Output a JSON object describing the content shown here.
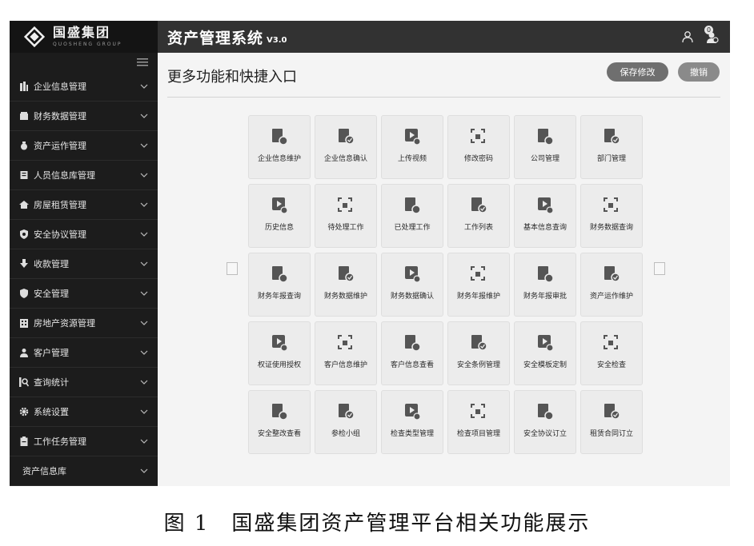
{
  "brand": {
    "name": "国盛集团",
    "sub": "QUOSHENG GROUP"
  },
  "system": {
    "title": "资产管理系统",
    "version": "V3.0"
  },
  "header": {
    "notification_count": "0"
  },
  "sidebar": {
    "items": [
      {
        "label": "企业信息管理",
        "icon": "building-icon"
      },
      {
        "label": "财务数据管理",
        "icon": "wallet-icon"
      },
      {
        "label": "资产运作管理",
        "icon": "money-bag-icon"
      },
      {
        "label": "人员信息库管理",
        "icon": "id-card-icon"
      },
      {
        "label": "房屋租赁管理",
        "icon": "house-icon"
      },
      {
        "label": "安全协议管理",
        "icon": "shield-gear-icon"
      },
      {
        "label": "收款管理",
        "icon": "download-icon"
      },
      {
        "label": "安全管理",
        "icon": "shield-icon"
      },
      {
        "label": "房地产资源管理",
        "icon": "office-building-icon"
      },
      {
        "label": "客户管理",
        "icon": "person-icon"
      },
      {
        "label": "查询统计",
        "icon": "search-doc-icon"
      },
      {
        "label": "系统设置",
        "icon": "gear-icon"
      },
      {
        "label": "工作任务管理",
        "icon": "clipboard-icon"
      },
      {
        "label": "资产信息库",
        "icon": ""
      }
    ]
  },
  "page": {
    "title": "更多功能和快捷入口",
    "save_label": "保存修改",
    "cancel_label": "撤销"
  },
  "tiles": [
    {
      "label": "企业信息维护",
      "icon": "doc-gear-icon"
    },
    {
      "label": "企业信息确认",
      "icon": "doc-check-icon"
    },
    {
      "label": "上传视频",
      "icon": "video-upload-icon"
    },
    {
      "label": "修改密码",
      "icon": "lock-scan-icon"
    },
    {
      "label": "公司管理",
      "icon": "doc-person-icon"
    },
    {
      "label": "部门管理",
      "icon": "shield-star-icon"
    },
    {
      "label": "历史信息",
      "icon": "barcode-icon"
    },
    {
      "label": "待处理工作",
      "icon": "doc-clock-icon"
    },
    {
      "label": "已处理工作",
      "icon": "doc-done-icon"
    },
    {
      "label": "工作列表",
      "icon": "clipboard-list-icon"
    },
    {
      "label": "基本信息查询",
      "icon": "doc-search-icon"
    },
    {
      "label": "财务数据查询",
      "icon": "magnifier-chart-icon"
    },
    {
      "label": "财务年报查询",
      "icon": "magnifier-icon"
    },
    {
      "label": "财务数据维护",
      "icon": "bars-gear-icon"
    },
    {
      "label": "财务数据确认",
      "icon": "bars-check-icon"
    },
    {
      "label": "财务年报维护",
      "icon": "trend-gear-icon"
    },
    {
      "label": "财务年报审批",
      "icon": "trend-check-icon"
    },
    {
      "label": "资产运作维护",
      "icon": "frame-gear-icon"
    },
    {
      "label": "权证使用授权",
      "icon": "certificate-icon"
    },
    {
      "label": "客户信息维护",
      "icon": "contact-card-icon"
    },
    {
      "label": "客户信息查看",
      "icon": "badge-card-icon"
    },
    {
      "label": "安全条例管理",
      "icon": "doc-shield-icon"
    },
    {
      "label": "安全模板定制",
      "icon": "blocks-icon"
    },
    {
      "label": "安全检查",
      "icon": "shield-star-icon"
    },
    {
      "label": "安全整改查看",
      "icon": "clipboard-edit-icon"
    },
    {
      "label": "参检小组",
      "icon": "group-icon"
    },
    {
      "label": "检查类型管理",
      "icon": "doc-edit-icon"
    },
    {
      "label": "检查项目管理",
      "icon": "folder-list-icon"
    },
    {
      "label": "安全协议订立",
      "icon": "shield-check-icon"
    },
    {
      "label": "租赁合同订立",
      "icon": "doc-gear2-icon"
    }
  ],
  "caption": "图 1　国盛集团资产管理平台相关功能展示"
}
